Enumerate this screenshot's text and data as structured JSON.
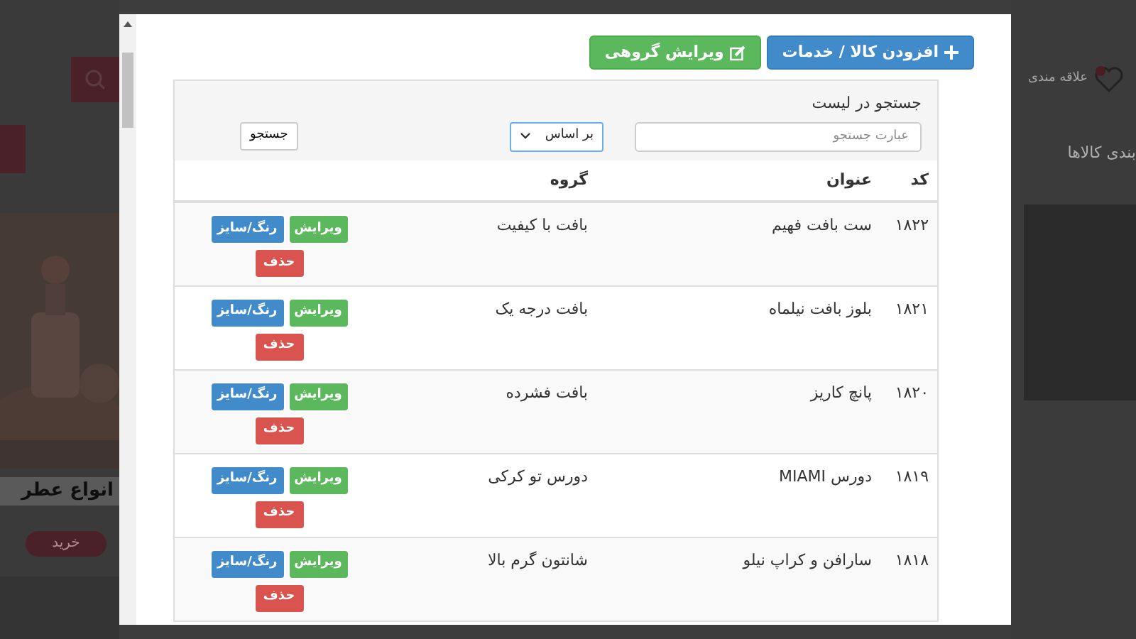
{
  "background": {
    "favorites_label": "علاقه مندی",
    "category_heading": "بندی کالاها",
    "promo_title": "انواع عطر",
    "promo_button": "خرید"
  },
  "toolbar": {
    "buttons": [
      {
        "label": "افزودن کالا / خدمات",
        "kind": "add"
      },
      {
        "label": "ویرایش گروهی",
        "kind": "bulk-edit"
      }
    ]
  },
  "search": {
    "label": "جستجو در لیست",
    "placeholder": "عبارت جستجو",
    "filter": "بر اساس",
    "button": "جستجو"
  },
  "table": {
    "columns": [
      "کد",
      "عنوان",
      "گروه"
    ],
    "rows": [
      {
        "code": "۱۸۲۲",
        "title": "ست بافت فهیم",
        "group": "بافت با کیفیت",
        "actions": [
          {
            "label": "ویرایش",
            "kind": "edit"
          },
          {
            "label": "رنگ/سایز",
            "kind": "variants"
          },
          {
            "label": "حذف",
            "kind": "delete"
          }
        ]
      },
      {
        "code": "۱۸۲۱",
        "title": "بلوز بافت نیلماه",
        "group": "بافت درجه یک",
        "actions": [
          {
            "label": "ویرایش",
            "kind": "edit"
          },
          {
            "label": "رنگ/سایز",
            "kind": "variants"
          },
          {
            "label": "حذف",
            "kind": "delete"
          }
        ]
      },
      {
        "code": "۱۸۲۰",
        "title": "پانچ کاریز",
        "group": "بافت فشرده",
        "actions": [
          {
            "label": "ویرایش",
            "kind": "edit"
          },
          {
            "label": "رنگ/سایز",
            "kind": "variants"
          },
          {
            "label": "حذف",
            "kind": "delete"
          }
        ]
      },
      {
        "code": "۱۸۱۹",
        "title": "دورس MIAMI",
        "group": "دورس تو کرکی",
        "actions": [
          {
            "label": "ویرایش",
            "kind": "edit"
          },
          {
            "label": "رنگ/سایز",
            "kind": "variants"
          },
          {
            "label": "حذف",
            "kind": "delete"
          }
        ]
      },
      {
        "code": "۱۸۱۸",
        "title": "سارافن و کراپ نیلو",
        "group": "شانتون گرم بالا",
        "actions": [
          {
            "label": "ویرایش",
            "kind": "edit"
          },
          {
            "label": "رنگ/سایز",
            "kind": "variants"
          },
          {
            "label": "حذف",
            "kind": "delete"
          }
        ]
      }
    ]
  }
}
